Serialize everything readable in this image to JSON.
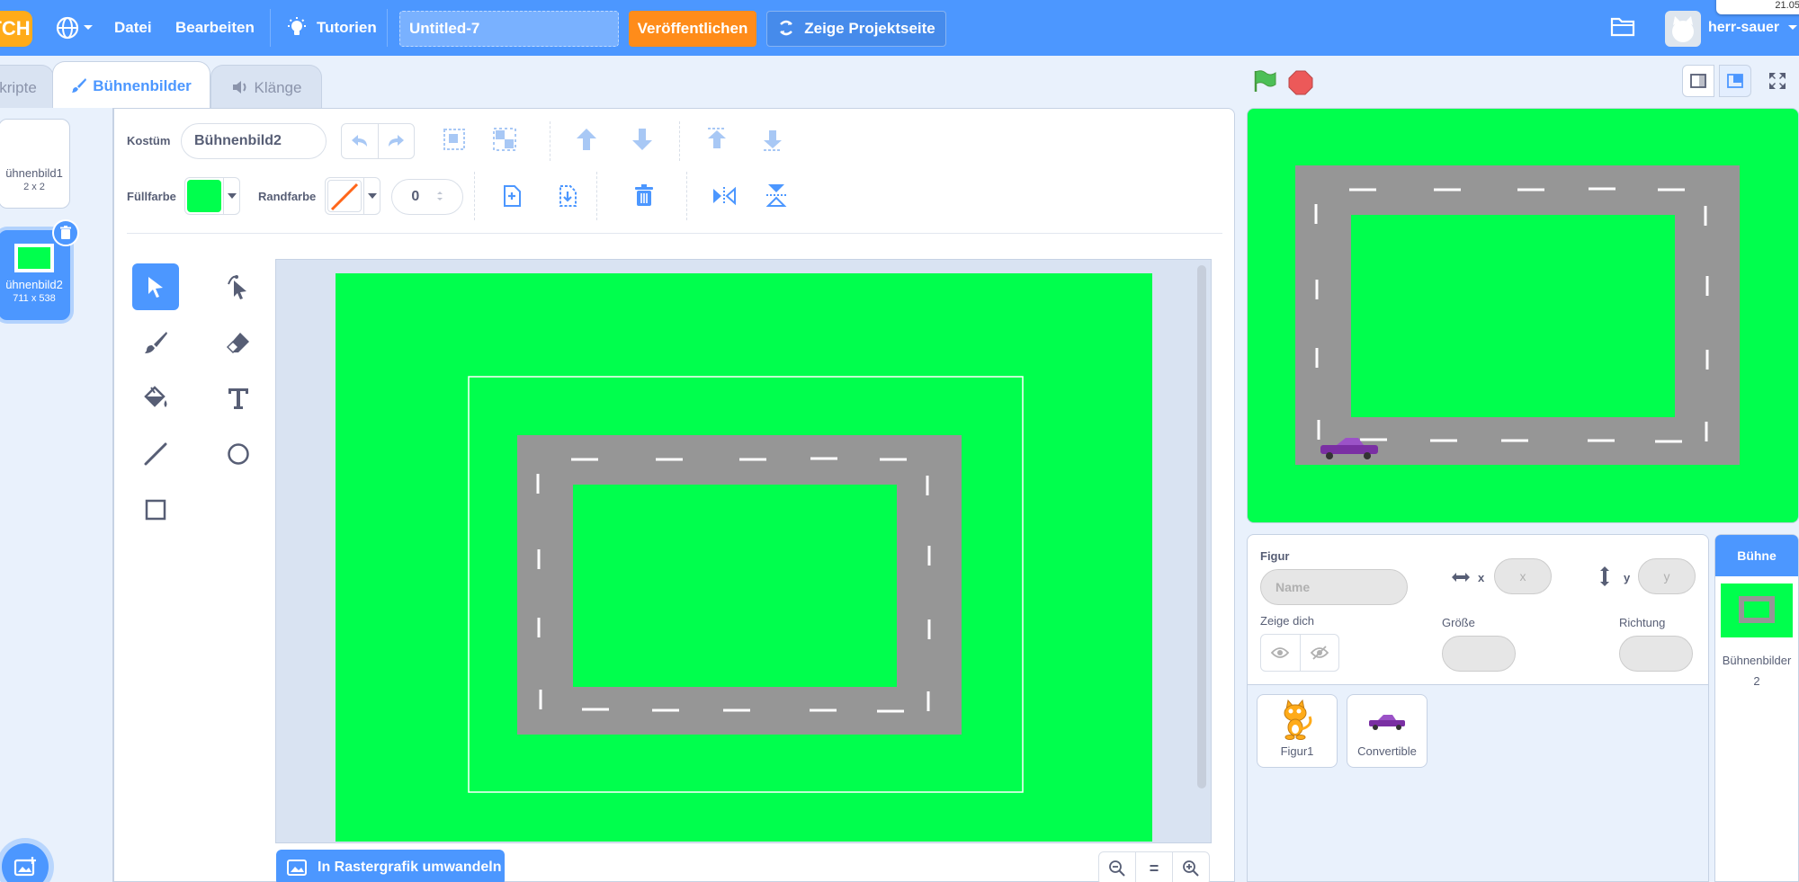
{
  "menubar": {
    "logo": "TCH",
    "file": "Datei",
    "edit": "Bearbeiten",
    "tutorials": "Tutorien",
    "project_title": "Untitled-7",
    "publish": "Veröffentlichen",
    "project_page": "Zeige Projektseite",
    "username": "herr-sauer",
    "notification": "21.05."
  },
  "tabs": {
    "code": "kripte",
    "costumes": "Bühnenbilder",
    "sounds": "Klänge"
  },
  "costumes": [
    {
      "name": "ühnenbild1",
      "size": "2 x 2"
    },
    {
      "name": "ühnenbild2",
      "size": "711 x 538"
    }
  ],
  "editor": {
    "costume_label": "Kostüm",
    "costume_name": "Bühnenbild2",
    "fill_label": "Füllfarbe",
    "outline_label": "Randfarbe",
    "outline_width": "0",
    "convert_button": "In Rastergrafik umwandeln",
    "fill_color": "#00ff4d",
    "zoom_reset": "="
  },
  "sprite_info": {
    "sprite_label": "Figur",
    "name_placeholder": "Name",
    "x_label": "x",
    "x_placeholder": "x",
    "y_label": "y",
    "y_placeholder": "y",
    "show_label": "Zeige dich",
    "size_label": "Größe",
    "direction_label": "Richtung"
  },
  "sprites": [
    {
      "name": "Figur1"
    },
    {
      "name": "Convertible"
    }
  ],
  "stage_pane": {
    "header": "Bühne",
    "backdrops_label": "Bühnenbilder",
    "backdrops_count": "2"
  },
  "colors": {
    "brand_blue": "#4c97ff",
    "publish_orange": "#ff8c1a",
    "grass_green": "#00ff4d",
    "road_gray": "#969696"
  }
}
